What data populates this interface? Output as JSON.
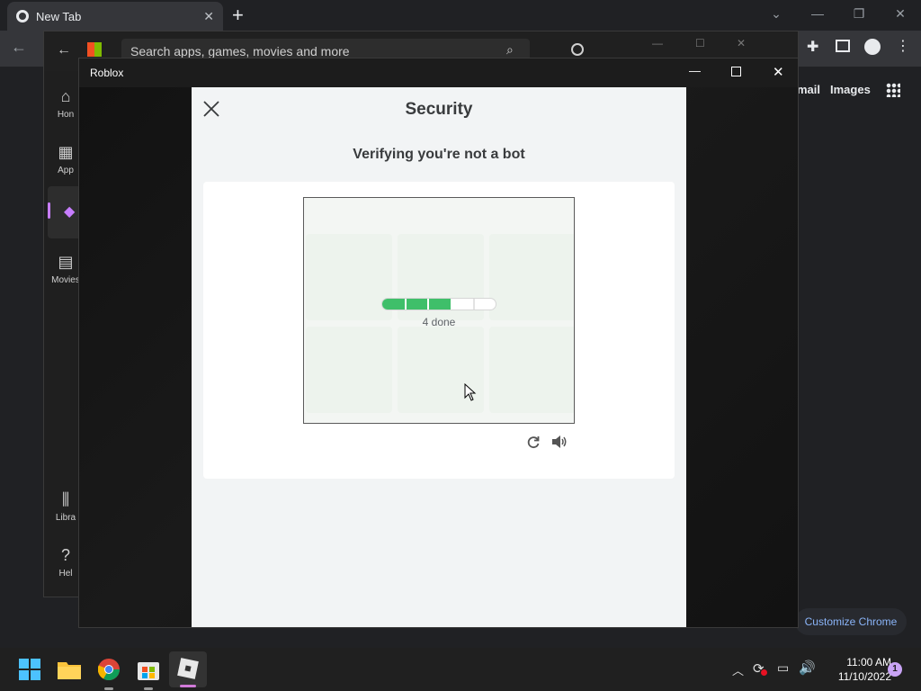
{
  "browser": {
    "tab_title": "New Tab",
    "new_tab_glyph": "+",
    "links": [
      "mail",
      "Images"
    ],
    "customize_label": "Customize Chrome"
  },
  "store": {
    "search_placeholder": "Search apps, games, movies and more",
    "nav": [
      "Hon",
      "App",
      "Movies",
      "Libra",
      "Hel"
    ]
  },
  "roblox": {
    "window_title": "Roblox"
  },
  "security": {
    "title": "Security",
    "subtitle": "Verifying you're not a bot",
    "progress_label": "4 done",
    "progress_fraction": 0.6,
    "progress_segments": 5
  },
  "taskbar": {
    "time": "11:00 AM",
    "date": "11/10/2022",
    "notification_count": "1",
    "apps": [
      "windows-start-icon",
      "file-explorer-icon",
      "chrome-icon",
      "microsoft-store-icon",
      "roblox-icon"
    ]
  },
  "colors": {
    "progress_green": "#3fbf6a",
    "modal_bg": "#f2f4f5"
  }
}
